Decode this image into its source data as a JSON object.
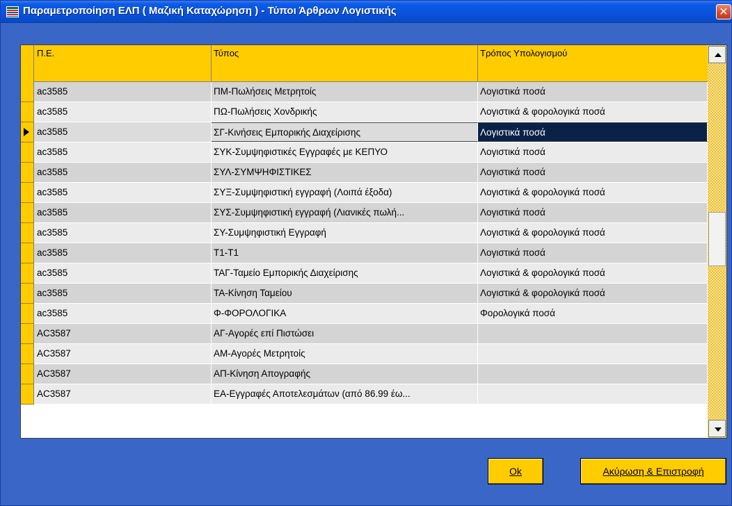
{
  "window": {
    "title": "Παραμετροποίηση ΕΛΠ ( Μαζική Καταχώρηση ) - Τύποι Άρθρων Λογιστικής",
    "close_glyph": "✕"
  },
  "grid": {
    "columns": [
      "Π.Ε.",
      "Τύπος",
      "Τρόπος Υπολογισμού"
    ],
    "selected_row_index": 2,
    "rows": [
      {
        "pe": "ac3585",
        "type": "ΠΜ-Πωλήσεις Μετρητοίς",
        "calc": "Λογιστικά ποσά"
      },
      {
        "pe": "ac3585",
        "type": "ΠΩ-Πωλήσεις Χονδρικής",
        "calc": "Λογιστικά & φορολογικά ποσά"
      },
      {
        "pe": "ac3585",
        "type": "ΣΓ-Κινήσεις Εμπορικής Διαχείρισης",
        "calc": "Λογιστικά ποσά"
      },
      {
        "pe": "ac3585",
        "type": "ΣΥΚ-Συμψηφιστικές Εγγραφές με ΚΕΠΥΟ",
        "calc": "Λογιστικά ποσά"
      },
      {
        "pe": "ac3585",
        "type": "ΣΥΛ-ΣΥΜΨΗΦΙΣΤΙΚΕΣ",
        "calc": "Λογιστικά ποσά"
      },
      {
        "pe": "ac3585",
        "type": "ΣΥΞ-Συμψηφιστική εγγραφή (Λοιπά έξοδα)",
        "calc": "Λογιστικά & φορολογικά ποσά"
      },
      {
        "pe": "ac3585",
        "type": "ΣΥΣ-Συμψηφιστική εγγραφή (Λιανικές πωλή...",
        "calc": "Λογιστικά ποσά"
      },
      {
        "pe": "ac3585",
        "type": "ΣΥ-Συμψηφιστική Εγγραφή",
        "calc": "Λογιστικά & φορολογικά ποσά"
      },
      {
        "pe": "ac3585",
        "type": "Τ1-Τ1",
        "calc": "Λογιστικά ποσά"
      },
      {
        "pe": "ac3585",
        "type": "ΤΑΓ-Ταμείο Εμπορικής Διαχείρισης",
        "calc": "Λογιστικά & φορολογικά ποσά"
      },
      {
        "pe": "ac3585",
        "type": "ΤΑ-Κίνηση Ταμείου",
        "calc": "Λογιστικά & φορολογικά ποσά"
      },
      {
        "pe": "ac3585",
        "type": "Φ-ΦΟΡΟΛΟΓΙΚΑ",
        "calc": "Φορολογικά ποσά"
      },
      {
        "pe": "AC3587",
        "type": "ΑΓ-Αγορές επί Πιστώσει",
        "calc": ""
      },
      {
        "pe": "AC3587",
        "type": "ΑΜ-Αγορές Μετρητοίς",
        "calc": ""
      },
      {
        "pe": "AC3587",
        "type": "ΑΠ-Κίνηση Απογραφής",
        "calc": ""
      },
      {
        "pe": "AC3587",
        "type": "ΕΑ-Εγγραφές Αποτελεσμάτων (από 86.99 έω...",
        "calc": ""
      }
    ]
  },
  "buttons": {
    "ok_label": "Ok",
    "cancel_label": "Ακύρωση & Επιστροφή"
  },
  "colors": {
    "accent": "#ffcc00",
    "selection": "#0a2148",
    "title_bar": "#0a52dc",
    "window_bg": "#3a66c8"
  }
}
